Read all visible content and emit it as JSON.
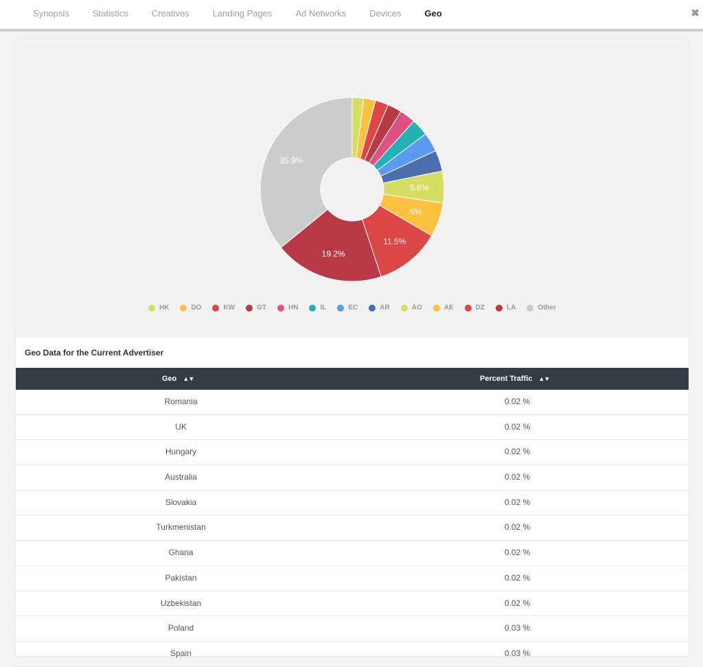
{
  "tabs": [
    {
      "label": "Synopsis",
      "active": false
    },
    {
      "label": "Statistics",
      "active": false
    },
    {
      "label": "Creatives",
      "active": false
    },
    {
      "label": "Landing Pages",
      "active": false
    },
    {
      "label": "Ad Networks",
      "active": false
    },
    {
      "label": "Devices",
      "active": false
    },
    {
      "label": "Geo",
      "active": true
    }
  ],
  "close_icon": "close-icon",
  "chart_data": {
    "type": "pie",
    "variant": "donut",
    "title": "",
    "categories": [
      "HK",
      "DO",
      "KW",
      "GT",
      "HN",
      "IL",
      "EC",
      "AR",
      "AO",
      "AE",
      "DZ",
      "LA",
      "Other"
    ],
    "values": [
      2.0,
      2.1,
      2.3,
      2.5,
      2.8,
      3.0,
      3.4,
      3.7,
      5.6,
      6.0,
      11.5,
      19.2,
      35.9
    ],
    "labels_shown": [
      "",
      "",
      "",
      "",
      "",
      "",
      "",
      "",
      "5.6%",
      "6%",
      "11.5%",
      "19.2%",
      "35.9%"
    ],
    "colors": [
      "#d5dd63",
      "#fdc13f",
      "#db4646",
      "#b83a47",
      "#dd5280",
      "#24b1b5",
      "#5b9bef",
      "#4b6eaf",
      "#d5dd63",
      "#fdc13f",
      "#db4646",
      "#b83a47",
      "#cccccc"
    ],
    "legend_position": "bottom"
  },
  "table": {
    "title": "Geo Data for the Current Advertiser",
    "columns": [
      "Geo",
      "Percent Traffic"
    ],
    "rows": [
      [
        "Romania",
        "0.02 %"
      ],
      [
        "UK",
        "0.02 %"
      ],
      [
        "Hungary",
        "0.02 %"
      ],
      [
        "Australia",
        "0.02 %"
      ],
      [
        "Slovakia",
        "0.02 %"
      ],
      [
        "Turkmenistan",
        "0.02 %"
      ],
      [
        "Ghana",
        "0.02 %"
      ],
      [
        "Pakistan",
        "0.02 %"
      ],
      [
        "Uzbekistan",
        "0.02 %"
      ],
      [
        "Poland",
        "0.03 %"
      ],
      [
        "Spain",
        "0.03 %"
      ]
    ]
  }
}
